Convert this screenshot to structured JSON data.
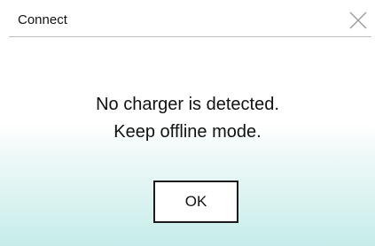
{
  "window": {
    "title": "Connect",
    "close_icon": "close-icon"
  },
  "message": {
    "line1": "No charger is detected.",
    "line2": "Keep offline mode."
  },
  "buttons": {
    "ok_label": "OK"
  },
  "colors": {
    "background_top": "#ffffff",
    "background_bottom": "#c6ecea",
    "button_border": "#1a1a1a",
    "divider": "#bdbdbd"
  }
}
